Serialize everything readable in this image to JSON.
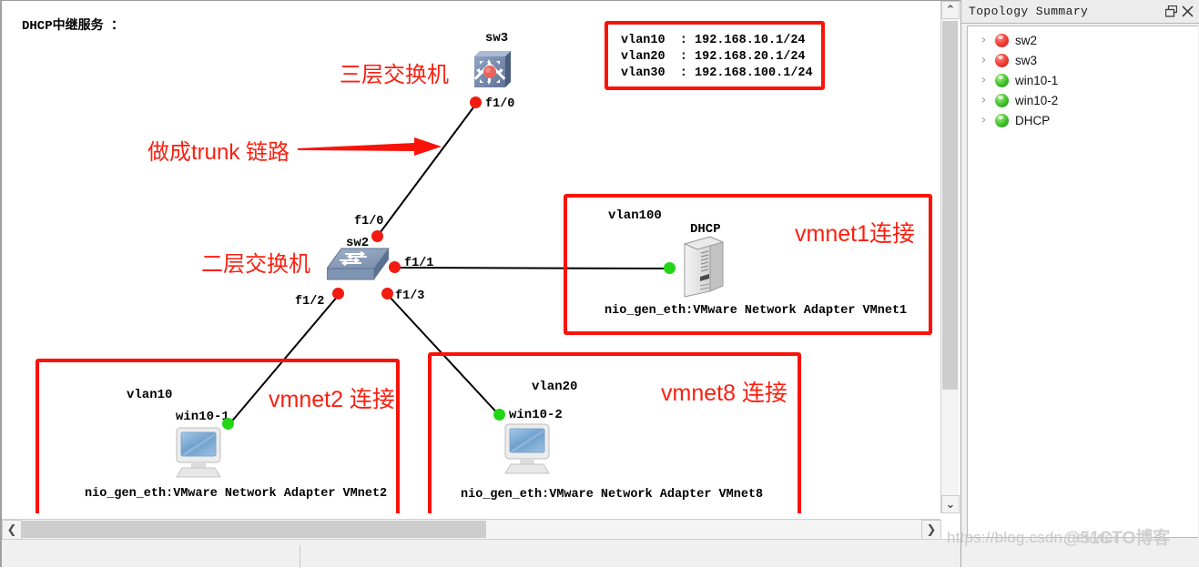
{
  "canvas": {
    "heading": "DHCP中继服务 ：",
    "annotations": {
      "l3_switch": "三层交换机",
      "trunk": "做成trunk 链路",
      "l2_switch": "二层交换机",
      "vmnet1": "vmnet1连接",
      "vmnet2": "vmnet2 连接",
      "vmnet8": "vmnet8 连接"
    },
    "vlan_box": {
      "lines": [
        "vlan10  : 192.168.10.1/24",
        "vlan20  : 192.168.20.1/24",
        "vlan30  : 192.168.100.1/24"
      ],
      "border_color": "#fb1209"
    },
    "nodes": {
      "sw3": {
        "name": "sw3",
        "port": "f1/0",
        "icon": "multilayer-switch-icon"
      },
      "sw2": {
        "name": "sw2",
        "icon": "switch-icon",
        "ports": {
          "up": "f1/0",
          "right": "f1/1",
          "left_down": "f1/2",
          "right_down": "f1/3"
        }
      },
      "dhcp": {
        "name": "DHCP",
        "vlan": "vlan100",
        "adapter": "nio_gen_eth:VMware Network Adapter VMnet1",
        "icon": "server-icon"
      },
      "win10_1": {
        "name": "win10-1",
        "vlan": "vlan10",
        "adapter": "nio_gen_eth:VMware Network Adapter VMnet2",
        "icon": "pc-icon"
      },
      "win10_2": {
        "name": "win10-2",
        "vlan": "vlan20",
        "adapter": "nio_gen_eth:VMware Network Adapter VMnet8",
        "icon": "pc-icon"
      }
    }
  },
  "dock": {
    "title": "Topology Summary",
    "buttons": {
      "float": "❐",
      "close": "✕"
    },
    "items": [
      {
        "label": "sw2",
        "status": "red"
      },
      {
        "label": "sw3",
        "status": "red"
      },
      {
        "label": "win10-1",
        "status": "green"
      },
      {
        "label": "win10-2",
        "status": "green"
      },
      {
        "label": "DHCP",
        "status": "green"
      }
    ]
  },
  "scrollbars": {
    "v_up": "⌃",
    "v_down": "⌄",
    "h_left": "❮",
    "h_right": "❯"
  },
  "watermark": {
    "url": "https://blog.csdn.net/wei",
    "brand": "@51CTO博客"
  }
}
